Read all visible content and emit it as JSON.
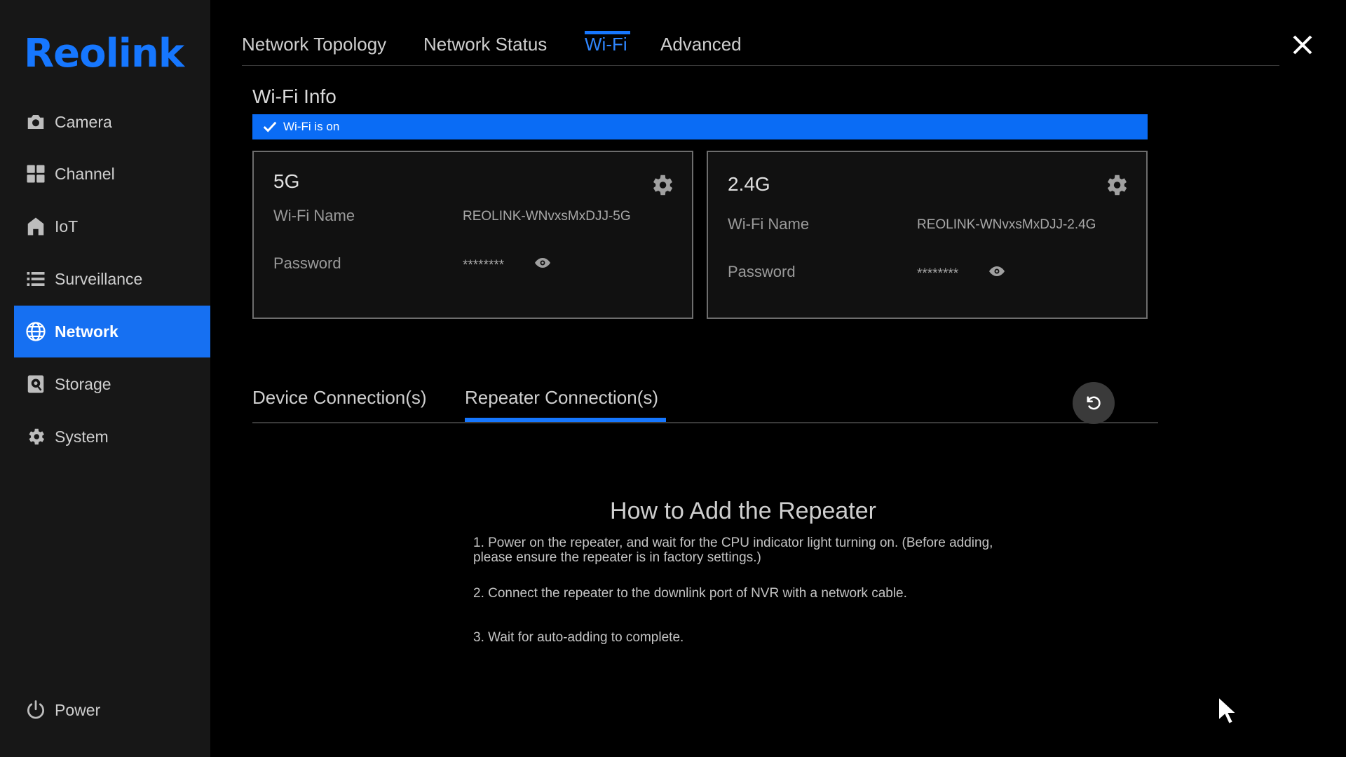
{
  "brand": {
    "logo": "Reolink",
    "accent": "#1677ff"
  },
  "sidebar": {
    "items": [
      {
        "label": "Camera",
        "icon": "camera-icon",
        "active": false
      },
      {
        "label": "Channel",
        "icon": "grid-icon",
        "active": false
      },
      {
        "label": "IoT",
        "icon": "home-icon",
        "active": false
      },
      {
        "label": "Surveillance",
        "icon": "list-icon",
        "active": false
      },
      {
        "label": "Network",
        "icon": "globe-icon",
        "active": true
      },
      {
        "label": "Storage",
        "icon": "storage-icon",
        "active": false
      },
      {
        "label": "System",
        "icon": "gear-icon",
        "active": false
      }
    ],
    "power": {
      "label": "Power",
      "icon": "power-icon"
    }
  },
  "top_tabs": [
    {
      "label": "Network Topology",
      "active": false
    },
    {
      "label": "Network Status",
      "active": false
    },
    {
      "label": "Wi-Fi",
      "active": true
    },
    {
      "label": "Advanced",
      "active": false
    }
  ],
  "wifi_info": {
    "title": "Wi-Fi Info",
    "status": "Wi-Fi is on",
    "bands": [
      {
        "band": "5G",
        "name_label": "Wi-Fi Name",
        "name": "REOLINK-WNvxsMxDJJ-5G",
        "password_label": "Password",
        "password": "********"
      },
      {
        "band": "2.4G",
        "name_label": "Wi-Fi Name",
        "name": "REOLINK-WNvxsMxDJJ-2.4G",
        "password_label": "Password",
        "password": "********"
      }
    ]
  },
  "sub_tabs": [
    {
      "label": "Device Connection(s)",
      "active": false
    },
    {
      "label": "Repeater Connection(s)",
      "active": true
    }
  ],
  "howto": {
    "title": "How to Add the Repeater",
    "steps": [
      "1. Power on the repeater, and wait for the CPU indicator light turning on. (Before adding, please ensure the repeater is in factory settings.)",
      "2. Connect the repeater to the downlink port of NVR with a network cable.",
      "3. Wait for auto-adding to complete."
    ]
  }
}
